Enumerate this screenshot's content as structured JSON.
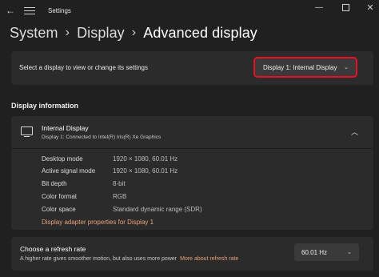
{
  "window": {
    "title": "Settings",
    "back_glyph": "←",
    "minimize_glyph": "—",
    "close_glyph": "✕"
  },
  "breadcrumb": {
    "items": [
      "System",
      "Display",
      "Advanced display"
    ],
    "separator": "›"
  },
  "select_display": {
    "label": "Select a display to view or change its settings",
    "value": "Display 1: Internal Display",
    "highlight_color": "#e81123"
  },
  "display_information": {
    "section_title": "Display information",
    "name": "Internal Display",
    "subtitle": "Display 1: Connected to Intel(R) Iris(R) Xe Graphics",
    "specs": [
      {
        "label": "Desktop mode",
        "value": "1920 × 1080, 60.01 Hz"
      },
      {
        "label": "Active signal mode",
        "value": "1920 × 1080, 60.01 Hz"
      },
      {
        "label": "Bit depth",
        "value": "8-bit"
      },
      {
        "label": "Color format",
        "value": "RGB"
      },
      {
        "label": "Color space",
        "value": "Standard dynamic range (SDR)"
      }
    ],
    "adapter_link": "Display adapter properties for Display 1"
  },
  "refresh_rate": {
    "title": "Choose a refresh rate",
    "description": "A higher rate gives smoother motion, but also uses more power",
    "link": "More about refresh rate",
    "value": "60.01 Hz"
  },
  "colors": {
    "background": "#202020",
    "card": "#2b2b2b",
    "link_accent": "#e8a27a"
  },
  "icons": {
    "chevron_down": "⌄",
    "chevron_up": "︿"
  }
}
